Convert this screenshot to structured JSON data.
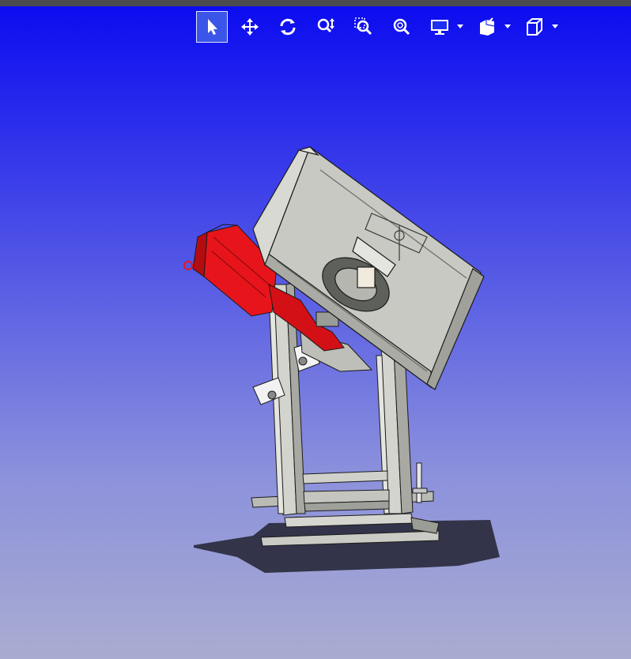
{
  "toolbar": {
    "buttons": [
      {
        "name": "select-tool",
        "icon": "cursor-arrow-icon",
        "active": true
      },
      {
        "name": "pan-tool",
        "icon": "move-arrows-icon",
        "active": false
      },
      {
        "name": "rotate-tool",
        "icon": "rotate-icon",
        "active": false
      },
      {
        "name": "zoom-tool",
        "icon": "zoom-updown-icon",
        "active": false
      },
      {
        "name": "zoom-window-tool",
        "icon": "zoom-window-icon",
        "active": false
      },
      {
        "name": "zoom-fit-tool",
        "icon": "zoom-fit-icon",
        "active": false
      },
      {
        "name": "display-mode-menu",
        "icon": "monitor-icon",
        "active": false
      },
      {
        "name": "section-view-menu",
        "icon": "section-view-icon",
        "active": false
      },
      {
        "name": "standard-views-menu",
        "icon": "cube-view-icon",
        "active": false
      }
    ]
  },
  "viewport": {
    "background_top": "#0a0af0",
    "background_bottom": "#a9acd0",
    "model_colors": {
      "housing": "#c7c9c2",
      "motor": "#e8141b",
      "frame": "#cfd1ca",
      "edges": "#1b1b1b"
    }
  }
}
